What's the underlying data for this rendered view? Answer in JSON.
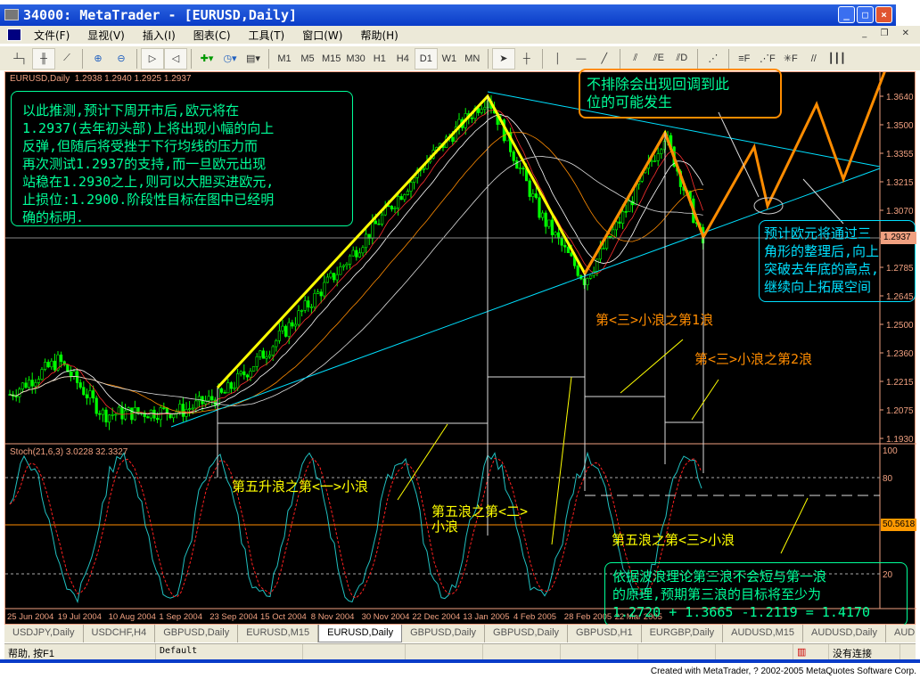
{
  "window": {
    "title": "34000: MetaTrader - [EURUSD,Daily]",
    "buttons": [
      "_",
      "□",
      "×"
    ]
  },
  "menu": [
    "文件(F)",
    "显视(V)",
    "插入(I)",
    "图表(C)",
    "工具(T)",
    "窗口(W)",
    "帮助(H)"
  ],
  "toolbar": {
    "timeframes": [
      "M1",
      "M5",
      "M15",
      "M30",
      "H1",
      "H4",
      "D1",
      "W1",
      "MN"
    ],
    "active_timeframe": "D1"
  },
  "chart": {
    "header": "EURUSD,Daily  1.2938 1.2940 1.2925 1.2937",
    "price_ticks": [
      "1.3640",
      "1.3500",
      "1.3355",
      "1.3215",
      "1.3070",
      "1.2937",
      "1.2785",
      "1.2645",
      "1.2500",
      "1.2360",
      "1.2215",
      "1.2075",
      "1.1930"
    ],
    "current_price": "1.2937",
    "stoch_header": "Stoch(21,6,3) 3.0228 32.3327",
    "stoch_ticks": [
      "100",
      "80",
      "20"
    ],
    "stoch_current": "50.5618",
    "dates": [
      "25 Jun 2004",
      "19 Jul 2004",
      "10 Aug 2004",
      "1 Sep 2004",
      "23 Sep 2004",
      "15 Oct 2004",
      "8 Nov 2004",
      "30 Nov 2004",
      "22 Dec 2004",
      "13 Jan 2005",
      "4 Feb 2005",
      "28 Feb 2005",
      "22 Mar 2005"
    ],
    "annotations": {
      "main_text": "以此推测,预计下周开市后,欧元将在\n1.2937(去年初头部)上将出现小幅的向上\n反弹,但随后将受挫于下行均线的压力而\n再次测试1.2937的支持,而一旦欧元出现\n站稳在1.2930之上,则可以大胆买进欧元,\n止损位:1.2900.阶段性目标在图中已经明\n确的标明.",
      "pullback": "不排除会出现回调到此\n位的可能发生",
      "triangle": "预计欧元将通过三\n角形的整理后,向上\n突破去年底的高点,\n继续向上拓展空间",
      "wave3_1": "第<三>小浪之第1浪",
      "wave3_2": "第<三>小浪之第2浪",
      "wave5_1": "第五升浪之第<一>小浪",
      "wave5_2": "第五浪之第<二>\n小浪",
      "wave5_3": "第五浪之第<三>小浪",
      "target": "依据波浪理论第三浪不会短与第一浪\n的原理,预期第三浪的目标将至少为\n1.2720 + 1.3665 -1.2119 = 1.4170"
    }
  },
  "tabs": [
    "USDJPY,Daily",
    "USDCHF,H4",
    "GBPUSD,Daily",
    "EURUSD,M15",
    "EURUSD,Daily",
    "GBPUSD,Daily",
    "GBPUSD,Daily",
    "GBPUSD,H1",
    "EURGBP,Daily",
    "AUDUSD,M15",
    "AUDUSD,Daily",
    "AUD"
  ],
  "active_tab": "EURUSD,Daily",
  "status": {
    "help": "帮助, 按F1",
    "profile": "Default",
    "connection": "没有连接"
  },
  "footer": "Created with MetaTrader, ? 2002-2005 MetaQuotes Software Corp.",
  "colors": {
    "bull": "#00ff00",
    "bear": "#00ff00",
    "axis": "#f0a080",
    "yellow": "#ffff00",
    "orange": "#ff8c00",
    "cyan": "#00e0ff",
    "text_green": "#00ff99"
  }
}
